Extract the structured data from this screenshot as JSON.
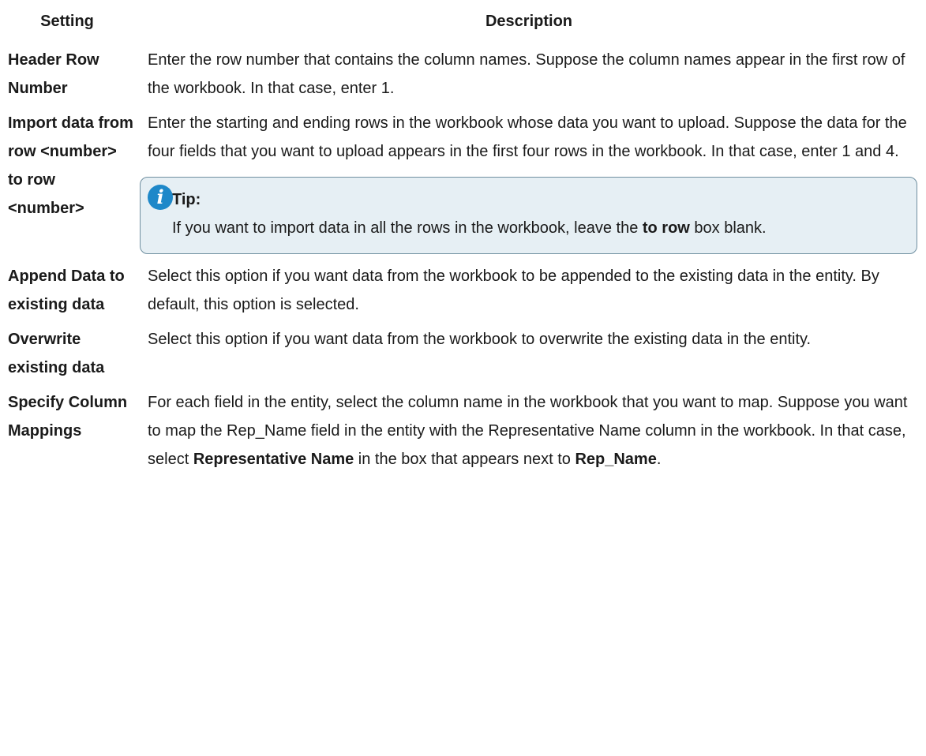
{
  "headers": {
    "setting": "Setting",
    "description": "Description"
  },
  "rows": [
    {
      "setting": "Header Row Number",
      "description": "Enter the row number that contains the column names. Suppose the column names appear in the first row of the workbook. In that case, enter 1."
    },
    {
      "setting": "Import data from row <number> to row <number>",
      "description": "Enter the starting and ending rows in the workbook whose data you want to upload. Suppose the data for the four fields that you want to upload appears in the first four rows in the workbook. In that case, enter 1 and 4.",
      "tip": {
        "icon": "info-icon",
        "title": "Tip:",
        "text_before": "If you want to import data in all the rows in the workbook, leave the ",
        "bold": "to row",
        "text_after": " box blank."
      }
    },
    {
      "setting": "Append Data to existing data",
      "description": "Select this option if you want data from the workbook to be appended to the existing data in the entity. By default, this option is selected."
    },
    {
      "setting": "Overwrite existing data",
      "description": "Select this option if you want data from the workbook to overwrite the existing data in the entity."
    },
    {
      "setting": "Specify Column Mappings",
      "description_before": "For each field in the entity, select the column name in the workbook that you want to map. Suppose you want to map the Rep_Name field in the entity with the Representative Name column in the workbook. In that case, select ",
      "bold1": "Representative Name",
      "description_middle": " in the box that appears next to ",
      "bold2": "Rep_Name",
      "description_after": "."
    }
  ]
}
